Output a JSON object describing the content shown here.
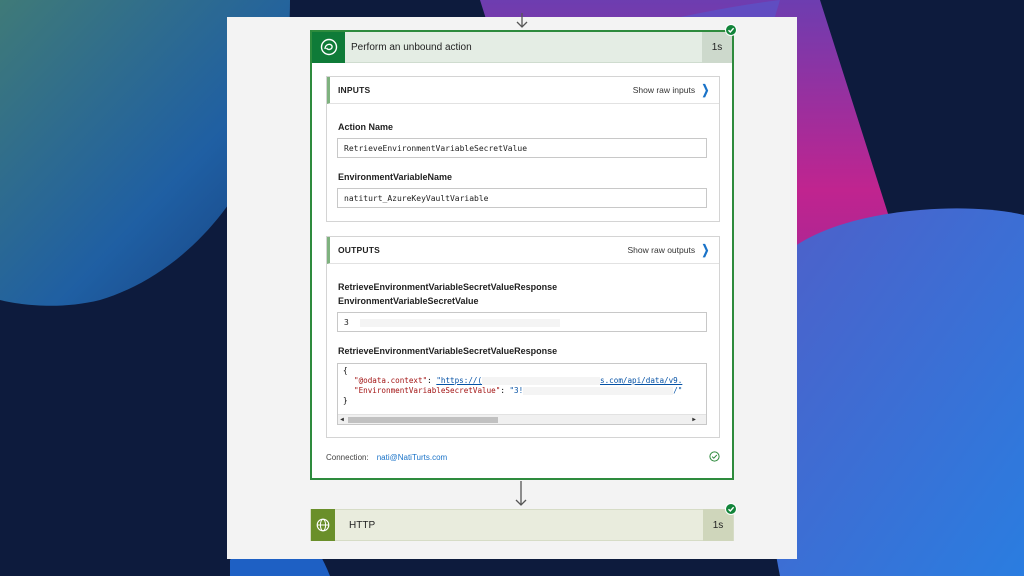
{
  "colors": {
    "accent_green": "#0f7b38",
    "success_check": "#12843a",
    "link_blue": "#1a73c8",
    "http_green": "#6a8f2a"
  },
  "action_card": {
    "icon": "dataverse-icon",
    "title": "Perform an unbound action",
    "duration": "1s",
    "status_icon": "success-check-icon",
    "inputs": {
      "title": "INPUTS",
      "raw_link": "Show raw inputs",
      "fields": [
        {
          "label": "Action Name",
          "value": "RetrieveEnvironmentVariableSecretValue"
        },
        {
          "label": "EnvironmentVariableName",
          "value": "natiturt_AzureKeyVaultVariable"
        }
      ]
    },
    "outputs": {
      "title": "OUTPUTS",
      "raw_link": "Show raw outputs",
      "secret_field": {
        "label_line1": "RetrieveEnvironmentVariableSecretValueResponse",
        "label_line2": "EnvironmentVariableSecretValue",
        "value": "3"
      },
      "response_field": {
        "label": "RetrieveEnvironmentVariableSecretValueResponse",
        "open_brace": "{",
        "line1_key": "\"@odata.context\"",
        "line1_sep": ": ",
        "line1_val_start": "\"https://(",
        "line1_val_end": "s.com/api/data/v9.",
        "line2_key": "\"EnvironmentVariableSecretValue\"",
        "line2_sep": ": ",
        "line2_val_start": "\"3!",
        "line2_val_end": "/\"",
        "close_brace": "}"
      }
    },
    "connection_label": "Connection:",
    "connection_value": "nati@NatiTurts.com"
  },
  "http_card": {
    "icon": "globe-icon",
    "title": "HTTP",
    "duration": "1s"
  }
}
